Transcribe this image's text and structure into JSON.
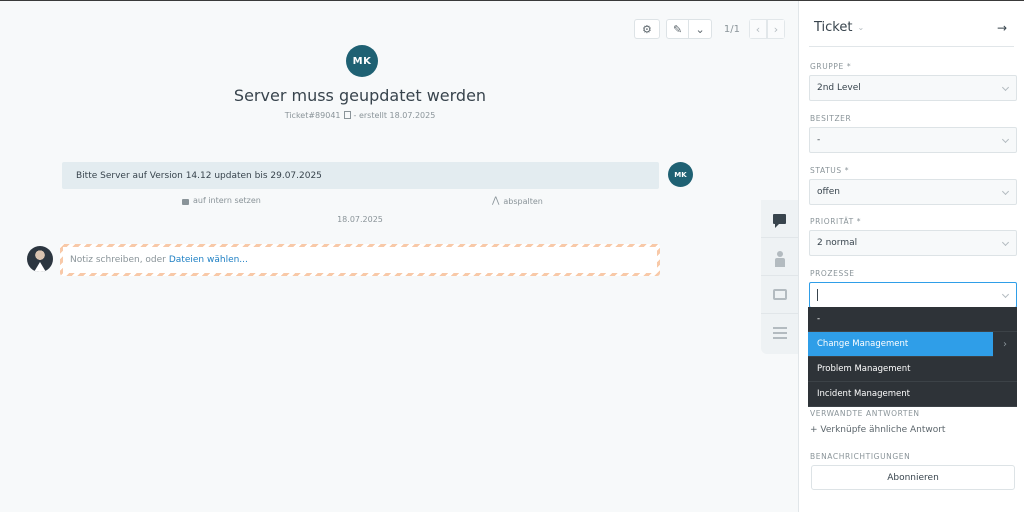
{
  "toolbar": {
    "pager": "1/1",
    "prev": "‹",
    "next": "›"
  },
  "ticket": {
    "avatar_initials": "MK",
    "title": "Server muss geupdatet werden",
    "number": "Ticket#89041",
    "created": "- erstellt 18.07.2025"
  },
  "article": {
    "text": "Bitte Server auf Version 14.12 updaten bis 29.07.2025",
    "avatar_initials": "MK",
    "action_intern": "auf intern setzen",
    "action_split": "abspalten",
    "date": "18.07.2025"
  },
  "note": {
    "placeholder": "Notiz schreiben, oder",
    "link": "Dateien wählen..."
  },
  "sidebar": {
    "header": "Ticket",
    "group_label": "GRUPPE *",
    "group_value": "2nd Level",
    "owner_label": "BESITZER",
    "owner_value": "-",
    "state_label": "STATUS *",
    "state_value": "offen",
    "priority_label": "PRIORITÄT *",
    "priority_value": "2 normal",
    "process_label": "PROZESSE",
    "process_options": [
      "-",
      "Change Management",
      "Problem Management",
      "Incident Management"
    ],
    "related_label": "VERWANDTE ANTWORTEN",
    "related_link": "+ Verknüpfe ähnliche Antwort",
    "notify_label": "BENACHRICHTIGUNGEN",
    "subscribe": "Abonnieren"
  }
}
